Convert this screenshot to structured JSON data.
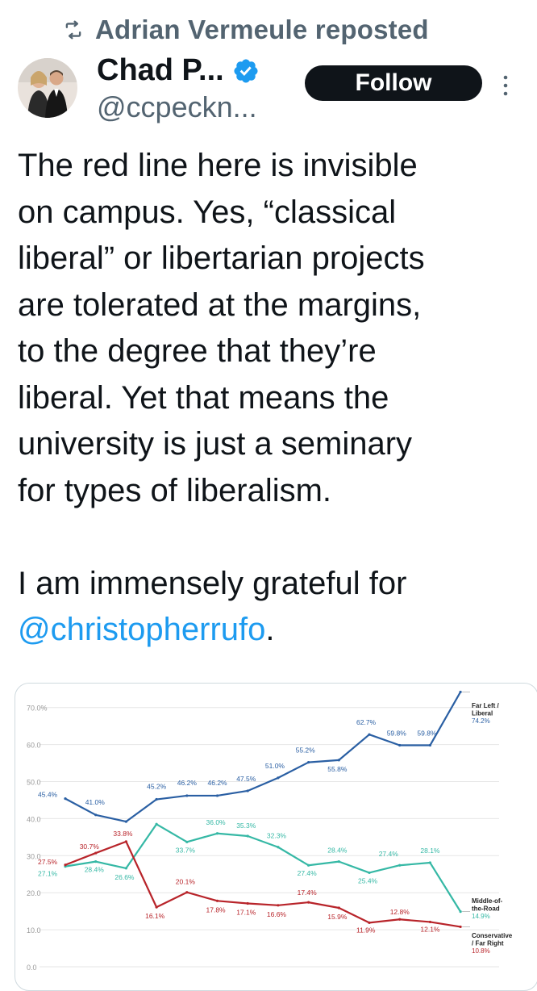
{
  "repost": {
    "text": "Adrian Vermeule reposted",
    "icon": "repost-icon"
  },
  "author": {
    "name": "Chad P...",
    "handle": "@ccpeckn...",
    "verified_icon": "verified-badge-icon",
    "verified_color": "#1d9bf0"
  },
  "follow_label": "Follow",
  "post": {
    "paragraph1": [
      "The red line here is invisible",
      "on campus. Yes, “classical",
      "liberal” or libertarian projects",
      "are tolerated at the margins,",
      "to the degree that they’re",
      "liberal. Yet that means the",
      "university is just a seminary",
      "for types of liberalism."
    ],
    "paragraph2_text": "I am immensely grateful for",
    "mention": "@christopherrufo",
    "mention_suffix": ".",
    "mention_color": "#1d9bf0"
  },
  "chart_data": {
    "type": "line",
    "ylim": [
      0,
      80
    ],
    "yticks": [
      "0.0",
      "10.0",
      "20.0",
      "30.0",
      "40.0",
      "50.0",
      "60.0",
      "70.0%"
    ],
    "grid": true,
    "series": [
      {
        "name": "Far Left / Liberal",
        "legend_lines": [
          "Far Left /",
          "Liberal",
          "74.2%"
        ],
        "color": "#2a5fa3",
        "points": [
          [
            0,
            45.4
          ],
          [
            1,
            41.0
          ],
          [
            2,
            39.2
          ],
          [
            3,
            45.2
          ],
          [
            4,
            46.2
          ],
          [
            5,
            46.2
          ],
          [
            6,
            47.5
          ],
          [
            7,
            51.0
          ],
          [
            8,
            55.2
          ],
          [
            9,
            55.8
          ],
          [
            10,
            62.7
          ],
          [
            11,
            59.8
          ],
          [
            12,
            59.8
          ],
          [
            13,
            74.2
          ]
        ],
        "labels": [
          {
            "i": 0,
            "t": "45.4%"
          },
          {
            "i": 1,
            "t": "41.0%"
          },
          {
            "i": 3,
            "t": "45.2%"
          },
          {
            "i": 4,
            "t": "46.2%"
          },
          {
            "i": 5,
            "t": "46.2%"
          },
          {
            "i": 6,
            "t": "47.5%"
          },
          {
            "i": 7,
            "t": "51.0%"
          },
          {
            "i": 8,
            "t": "55.2%"
          },
          {
            "i": 9,
            "t": "55.8%"
          },
          {
            "i": 10,
            "t": "62.7%"
          },
          {
            "i": 11,
            "t": "59.8%"
          },
          {
            "i": 12,
            "t": "59.8%"
          }
        ]
      },
      {
        "name": "Middle-of-the-Road",
        "legend_lines": [
          "Middle-of-",
          "the-Road",
          "14.9%"
        ],
        "color": "#35b8a5",
        "points": [
          [
            0,
            27.1
          ],
          [
            1,
            28.4
          ],
          [
            2,
            26.6
          ],
          [
            3,
            38.5
          ],
          [
            4,
            33.7
          ],
          [
            5,
            36.0
          ],
          [
            6,
            35.3
          ],
          [
            7,
            32.3
          ],
          [
            8,
            27.4
          ],
          [
            9,
            28.4
          ],
          [
            10,
            25.4
          ],
          [
            11,
            27.4
          ],
          [
            12,
            28.1
          ],
          [
            13,
            14.9
          ]
        ],
        "labels": [
          {
            "i": 0,
            "t": "27.1%"
          },
          {
            "i": 1,
            "t": "28.4%"
          },
          {
            "i": 2,
            "t": "26.6%"
          },
          {
            "i": 4,
            "t": "33.7%"
          },
          {
            "i": 5,
            "t": "36.0%"
          },
          {
            "i": 6,
            "t": "35.3%"
          },
          {
            "i": 7,
            "t": "32.3%"
          },
          {
            "i": 8,
            "t": "27.4%"
          },
          {
            "i": 9,
            "t": "28.4%"
          },
          {
            "i": 10,
            "t": "25.4%"
          },
          {
            "i": 11,
            "t": "27.4%"
          },
          {
            "i": 12,
            "t": "28.1%"
          }
        ]
      },
      {
        "name": "Conservative / Far Right",
        "legend_lines": [
          "Conservative",
          "/ Far Right",
          "10.8%"
        ],
        "color": "#b8242a",
        "points": [
          [
            0,
            27.5
          ],
          [
            1,
            30.7
          ],
          [
            2,
            33.8
          ],
          [
            3,
            16.1
          ],
          [
            4,
            20.1
          ],
          [
            5,
            17.8
          ],
          [
            6,
            17.1
          ],
          [
            7,
            16.6
          ],
          [
            8,
            17.4
          ],
          [
            9,
            15.9
          ],
          [
            10,
            11.9
          ],
          [
            11,
            12.8
          ],
          [
            12,
            12.1
          ],
          [
            13,
            10.8
          ]
        ],
        "labels": [
          {
            "i": 0,
            "t": "27.5%"
          },
          {
            "i": 1,
            "t": "30.7%"
          },
          {
            "i": 2,
            "t": "33.8%"
          },
          {
            "i": 3,
            "t": "16.1%"
          },
          {
            "i": 4,
            "t": "20.1%"
          },
          {
            "i": 5,
            "t": "17.8%"
          },
          {
            "i": 6,
            "t": "17.1%"
          },
          {
            "i": 7,
            "t": "16.6%"
          },
          {
            "i": 8,
            "t": "17.4%"
          },
          {
            "i": 9,
            "t": "15.9%"
          },
          {
            "i": 10,
            "t": "11.9%"
          },
          {
            "i": 11,
            "t": "12.8%"
          },
          {
            "i": 12,
            "t": "12.1%"
          }
        ]
      }
    ]
  }
}
